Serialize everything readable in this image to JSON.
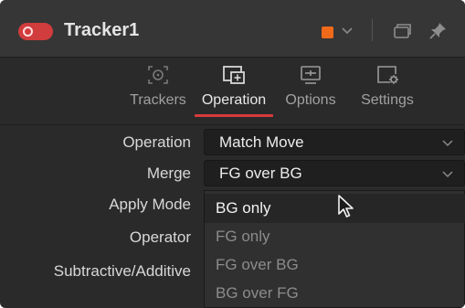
{
  "header": {
    "title": "Tracker1",
    "enabled": true,
    "color_swatch": "#f06a1a",
    "icons": [
      "swatch-chevron-icon",
      "window-icon",
      "pin-icon"
    ]
  },
  "tabs": [
    {
      "label": "Trackers",
      "icon": "target-icon",
      "active": false
    },
    {
      "label": "Operation",
      "icon": "operation-icon",
      "active": true
    },
    {
      "label": "Options",
      "icon": "options-icon",
      "active": false
    },
    {
      "label": "Settings",
      "icon": "settings-icon",
      "active": false
    }
  ],
  "fields": {
    "operation": {
      "label": "Operation",
      "value": "Match Move"
    },
    "merge": {
      "label": "Merge",
      "value": "FG over BG"
    },
    "apply_mode": {
      "label": "Apply Mode"
    },
    "operator": {
      "label": "Operator"
    },
    "subtractive_additive": {
      "label": "Subtractive/Additive"
    }
  },
  "merge_menu": {
    "options": [
      "BG only",
      "FG only",
      "FG over BG",
      "BG over FG"
    ],
    "hovered": "BG only"
  },
  "colors": {
    "accent_red": "#d83a3a",
    "orange": "#f06a1a"
  }
}
